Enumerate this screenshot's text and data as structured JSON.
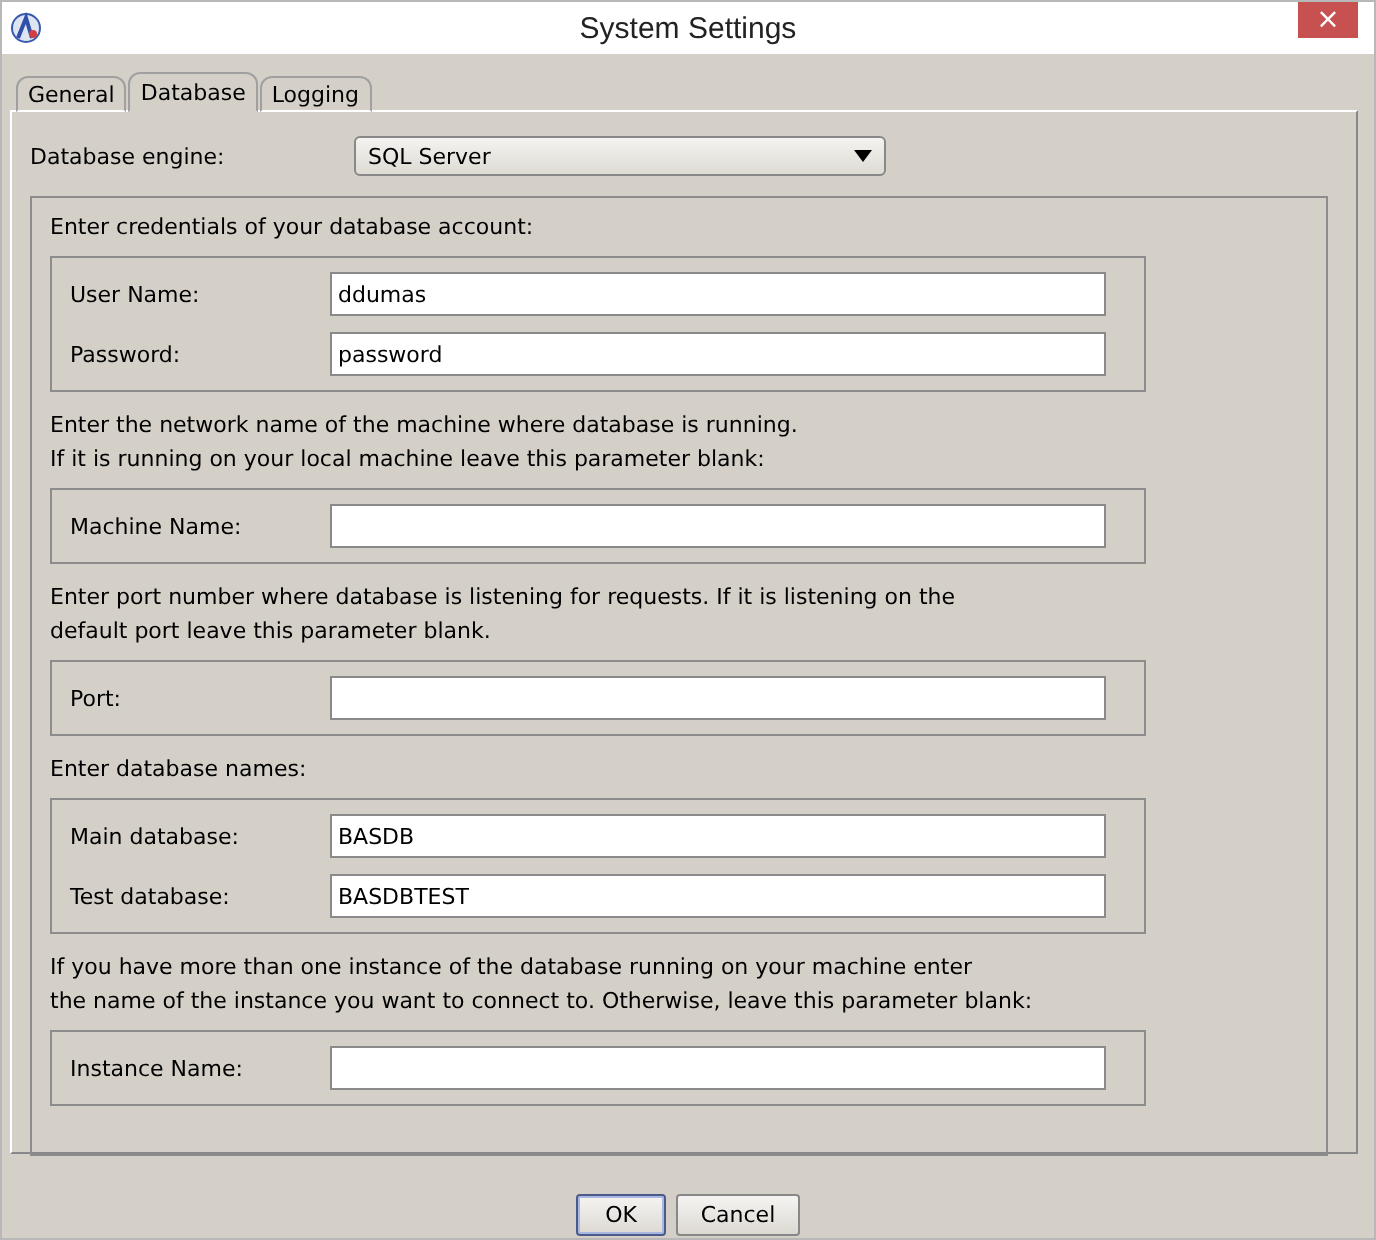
{
  "window": {
    "title": "System Settings",
    "close": "×"
  },
  "tabs": [
    {
      "label": "General",
      "selected": false
    },
    {
      "label": "Database",
      "selected": true
    },
    {
      "label": "Logging",
      "selected": false
    }
  ],
  "engine": {
    "label": "Database engine:",
    "value": "SQL Server"
  },
  "sections": [
    {
      "prompt": [
        "Enter credentials of your database account:"
      ],
      "fields": [
        {
          "label": "User Name:",
          "value": "ddumas"
        },
        {
          "label": "Password:",
          "value": "password"
        }
      ]
    },
    {
      "prompt": [
        "Enter the network name of the machine where database is running.",
        "If it is running on your local machine leave this parameter blank:"
      ],
      "fields": [
        {
          "label": "Machine Name:"
        }
      ]
    },
    {
      "prompt": [
        "Enter port number where database is listening for requests. If it is listening on the",
        "default port leave this parameter blank."
      ],
      "fields": [
        {
          "label": "Port:"
        }
      ]
    },
    {
      "prompt": [
        "Enter database names:"
      ],
      "fields": [
        {
          "label": "Main database:",
          "value": "BASDB"
        },
        {
          "label": "Test database:",
          "value": "BASDBTEST"
        }
      ]
    },
    {
      "prompt": [
        "If you have more than one instance of the database running on your machine enter",
        "the name of the instance you want to connect to. Otherwise, leave this parameter blank:"
      ],
      "fields": [
        {
          "label": "Instance Name:"
        }
      ]
    }
  ],
  "buttons": [
    {
      "label": "OK",
      "default": true
    },
    {
      "label": "Cancel",
      "default": false
    }
  ]
}
